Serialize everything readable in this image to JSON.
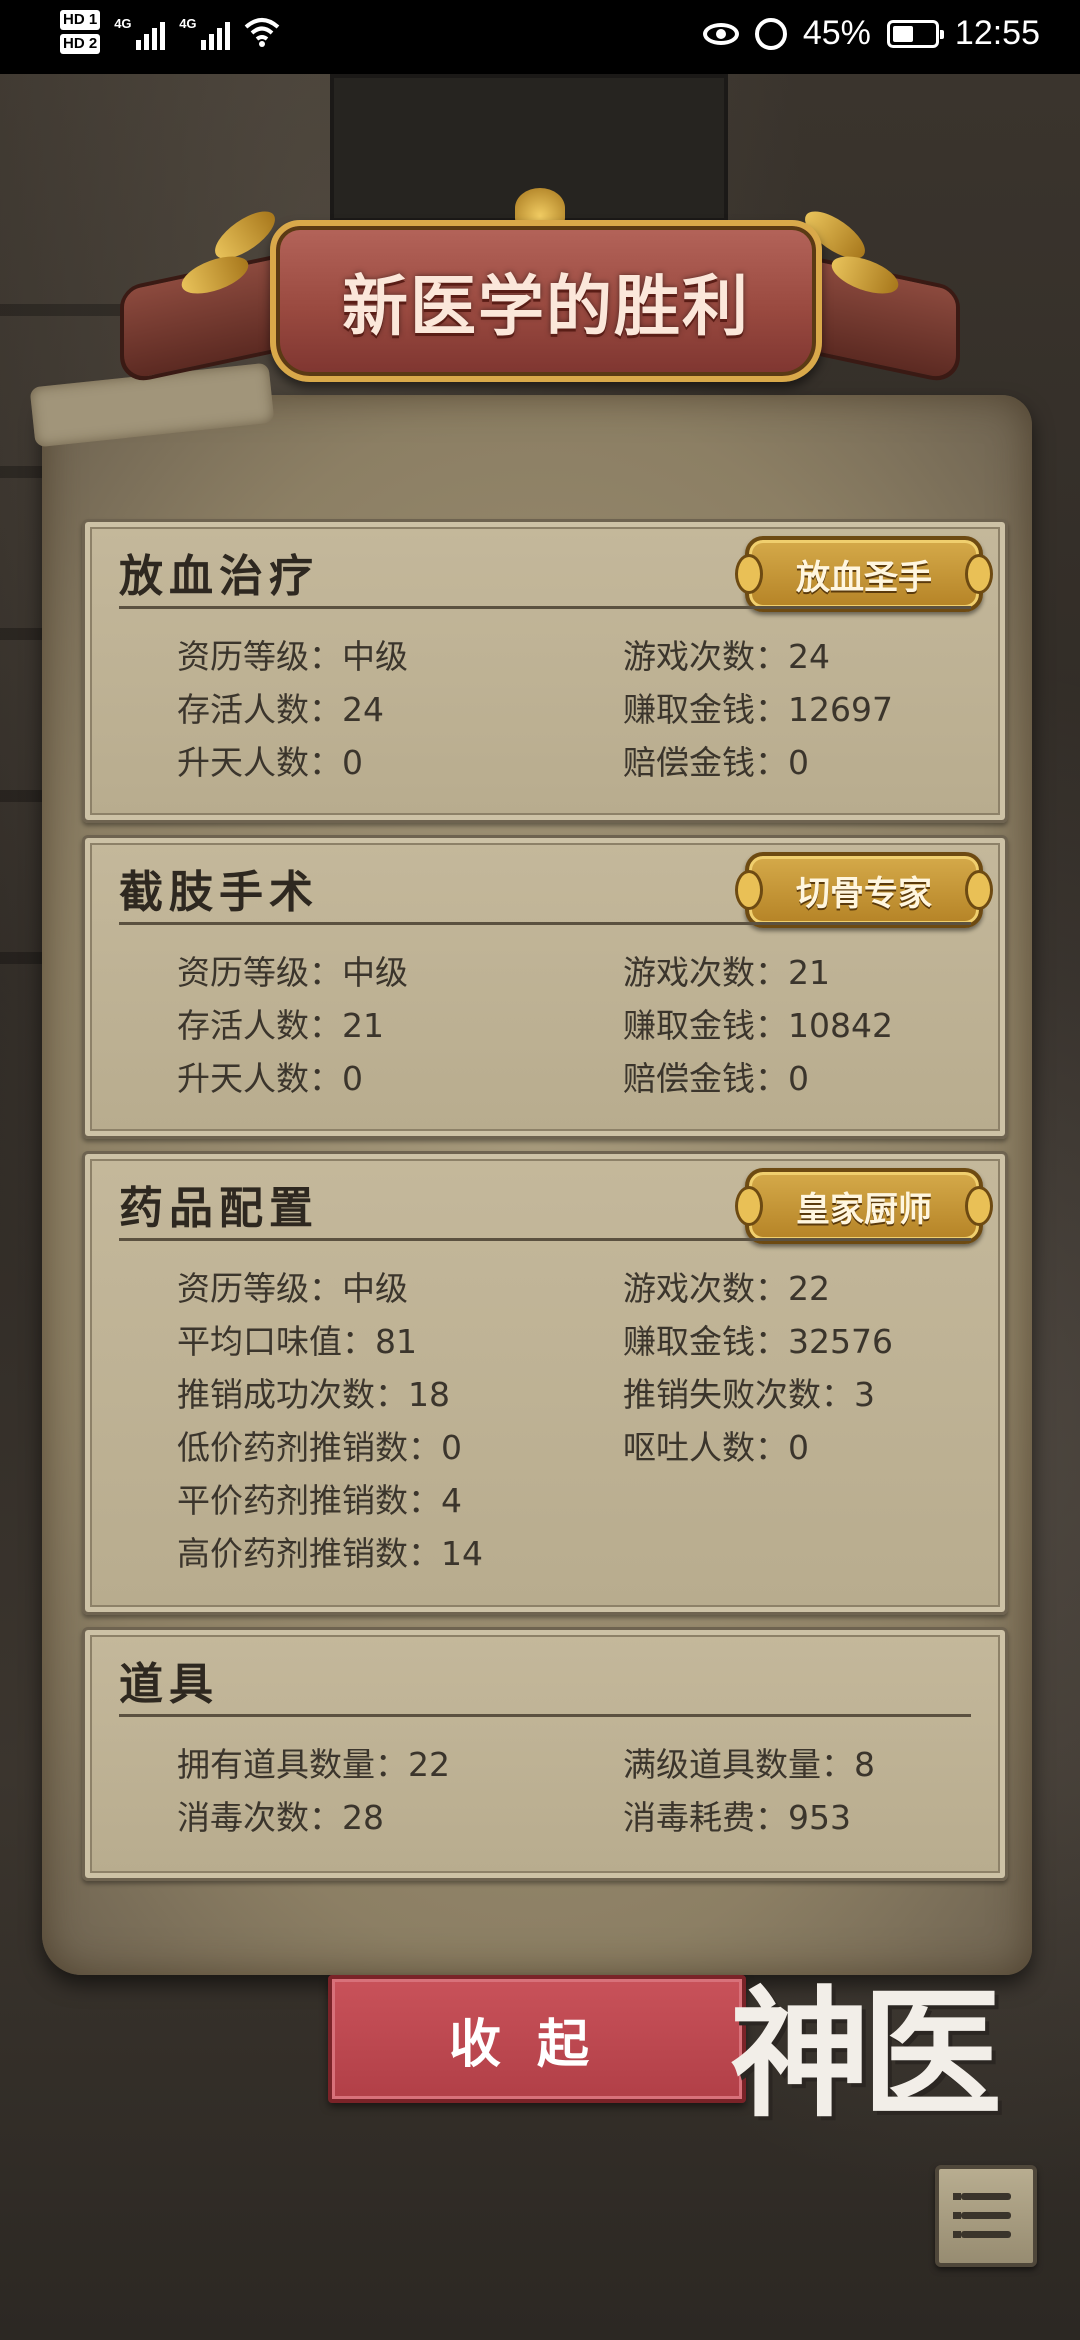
{
  "status_bar": {
    "hd1": "HD 1",
    "hd2": "HD 2",
    "net1": "4G",
    "net2": "4G",
    "battery_percent": "45%",
    "time": "12:55"
  },
  "title": "新医学的胜利",
  "sections": [
    {
      "heading": "放血治疗",
      "badge": "放血圣手",
      "stats": [
        "资历等级：中级",
        "游戏次数：24",
        "存活人数：24",
        "赚取金钱：12697",
        "升天人数：0",
        "赔偿金钱：0"
      ]
    },
    {
      "heading": "截肢手术",
      "badge": "切骨专家",
      "stats": [
        "资历等级：中级",
        "游戏次数：21",
        "存活人数：21",
        "赚取金钱：10842",
        "升天人数：0",
        "赔偿金钱：0"
      ]
    },
    {
      "heading": "药品配置",
      "badge": "皇家厨师",
      "stats": [
        "资历等级：中级",
        "游戏次数：22",
        "平均口味值：81",
        "赚取金钱：32576",
        "推销成功次数：18",
        "推销失败次数：3",
        "低价药剂推销数：0",
        "呕吐人数：0",
        "平价药剂推销数：4",
        "",
        "高价药剂推销数：14",
        ""
      ]
    },
    {
      "heading": "道具",
      "stats": [
        "拥有道具数量：22",
        "满级道具数量：8",
        "消毒次数：28",
        "消毒耗费：953"
      ]
    }
  ],
  "collapse_button": "收起",
  "logo_text": "神医",
  "icons": {
    "menu": "menu-list-icon",
    "eye": "eye-icon",
    "alarm": "alarm-icon",
    "battery": "battery-icon",
    "wifi": "wifi-icon",
    "signal": "signal-icon"
  },
  "colors": {
    "button_red": "#c24a52",
    "badge_gold": "#c99a3a",
    "title_ribbon": "#9a4a40",
    "parchment": "#b8ac8e"
  }
}
